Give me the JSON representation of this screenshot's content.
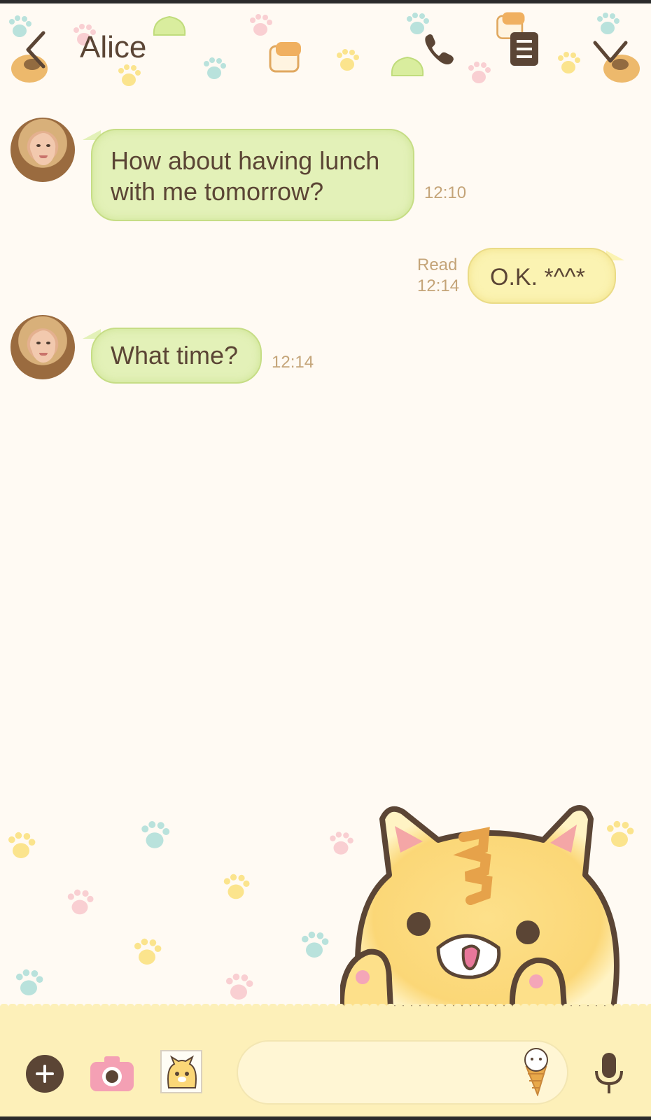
{
  "header": {
    "title": "Alice"
  },
  "messages": [
    {
      "direction": "incoming",
      "lines": [
        "How about having lunch",
        "with me tomorrow?"
      ],
      "time": "12:10"
    },
    {
      "direction": "outgoing",
      "text": "O.K. *^^*",
      "read_label": "Read",
      "time": "12:14"
    },
    {
      "direction": "incoming",
      "text": "What time?",
      "time": "12:14"
    }
  ],
  "input": {
    "value": "",
    "placeholder": ""
  },
  "colors": {
    "background": "#fffaf3",
    "text": "#5b4535",
    "incoming_bubble": "#e3f1b8",
    "outgoing_bubble": "#fbf3b2",
    "timestamp": "#c4a478",
    "bottom_bar": "#fdf0b9"
  },
  "icons": {
    "back": "chevron-left-icon",
    "call": "phone-icon",
    "menu": "menu-icon",
    "collapse": "chevron-down-icon",
    "attach": "plus-icon",
    "camera": "camera-icon",
    "sticker": "sticker-icon",
    "emoji": "emoji-icon",
    "voice": "microphone-icon"
  }
}
